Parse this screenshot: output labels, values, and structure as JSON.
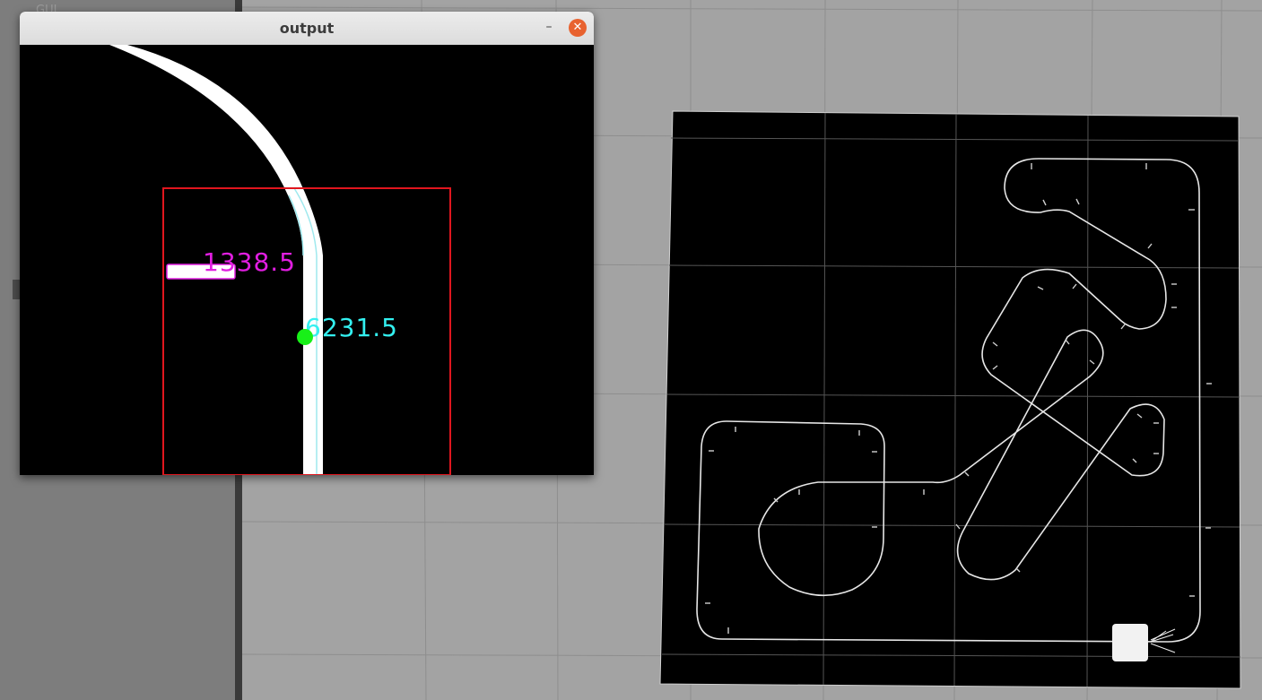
{
  "window": {
    "title": "output",
    "minimize_glyph": "–",
    "close_glyph": "✕"
  },
  "detection": {
    "left_value": "1338.5",
    "center_value": "6231.5",
    "left_value_color": "#e11ee1",
    "center_value_color": "#33f0f0",
    "roi_color": "#e0161e",
    "center_point_color": "#18f018",
    "line_color": "#ffffff"
  },
  "viewport": {
    "background_color": "#a3a3a3",
    "grid_color": "#8d8d8d",
    "map_color": "#000000"
  },
  "left_panel": {
    "ghost_label": "GUI"
  }
}
